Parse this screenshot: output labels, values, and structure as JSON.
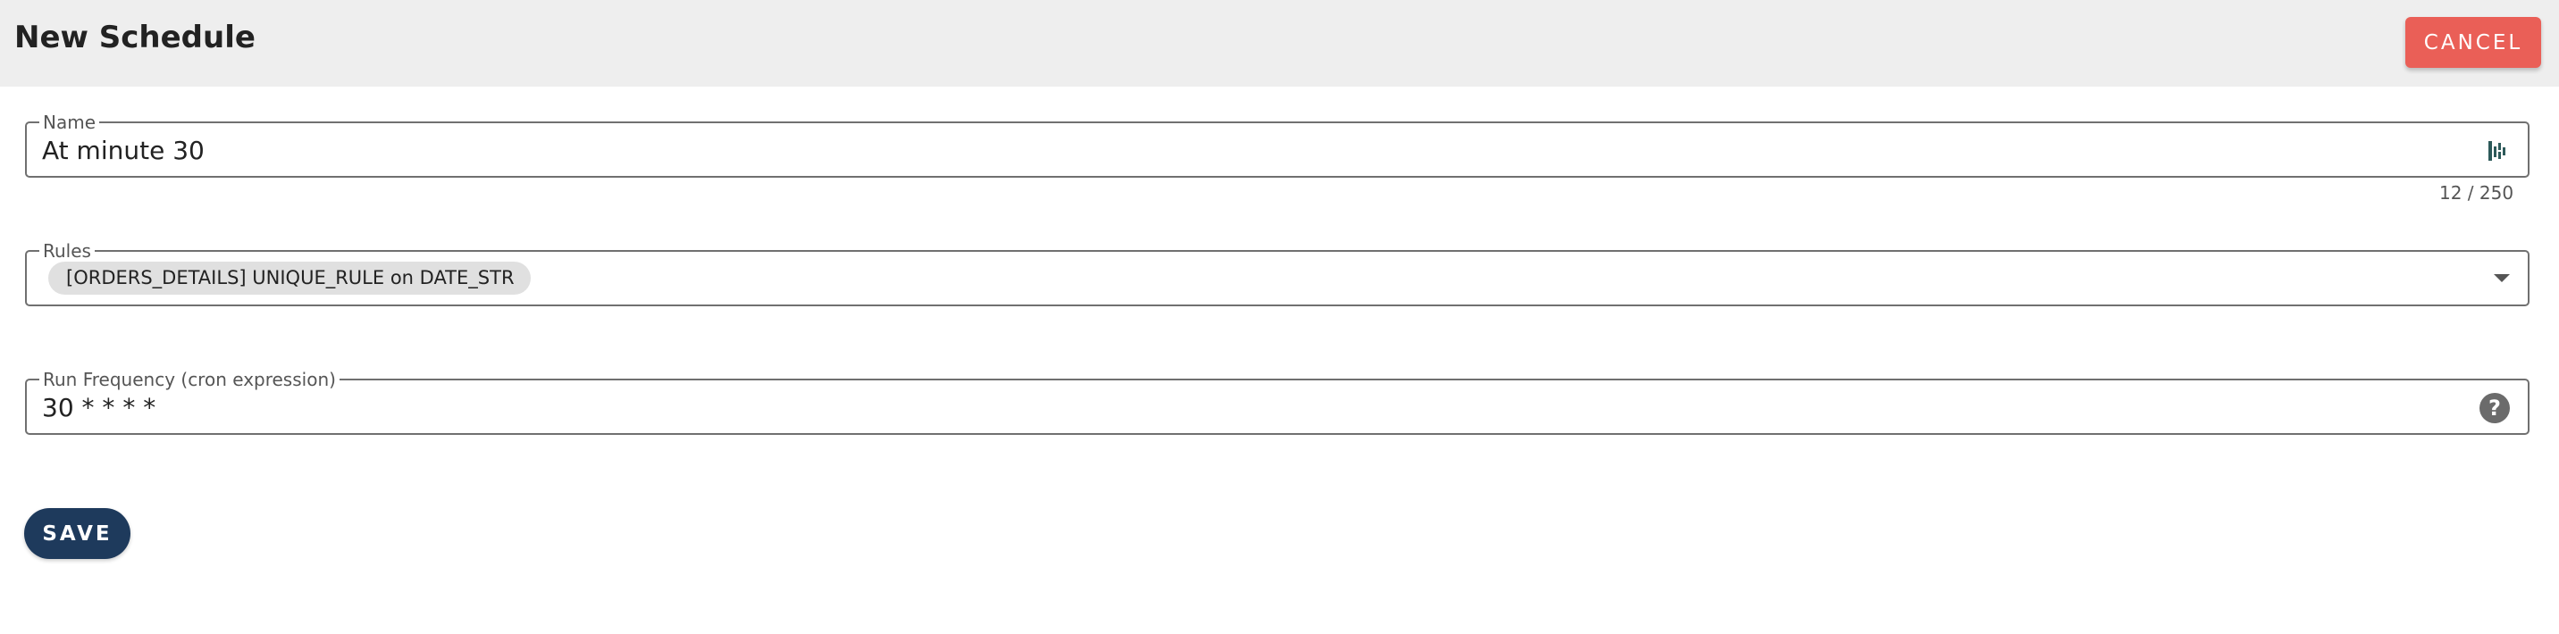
{
  "header": {
    "title": "New Schedule",
    "cancel_label": "CANCEL",
    "cancel_color": "#ea5f57"
  },
  "form": {
    "name": {
      "label": "Name",
      "value": "At minute 30",
      "counter": "12 / 250",
      "end_icon": "grammar-assistant-icon"
    },
    "rules": {
      "label": "Rules",
      "chips": [
        "[ORDERS_DETAILS] UNIQUE_RULE on DATE_STR"
      ],
      "dropdown_icon": "chevron-down-icon"
    },
    "run_frequency": {
      "label": "Run Frequency (cron expression)",
      "value": "30 * * * *",
      "help_icon": "help-icon",
      "help_glyph": "?"
    }
  },
  "footer": {
    "save_label": "SAVE",
    "save_color": "#1e3a5c"
  }
}
